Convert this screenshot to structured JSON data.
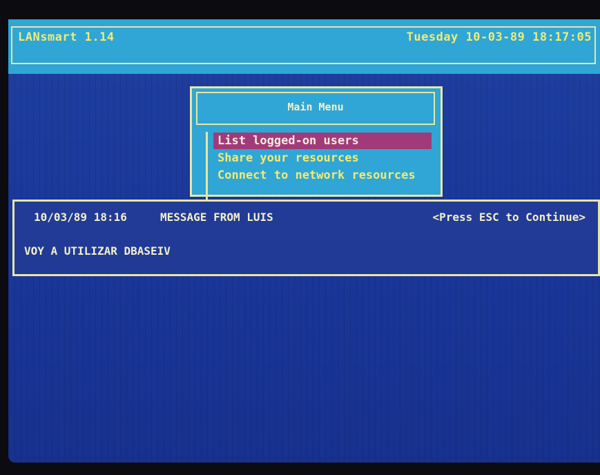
{
  "header": {
    "app_title": "LANsmart 1.14",
    "datetime": "Tuesday 10-03-89 18:17:05"
  },
  "menu": {
    "title": "Main Menu",
    "items": [
      {
        "label": "List logged-on users",
        "selected": true
      },
      {
        "label": "Share your resources",
        "selected": false
      },
      {
        "label": "Connect to network resources",
        "selected": false
      }
    ]
  },
  "message": {
    "date_time": "10/03/89 18:16",
    "from": "MESSAGE FROM LUIS",
    "hint": "<Press ESC to Continue>",
    "body": "VOY A UTILIZAR DBASEIV"
  },
  "colors": {
    "background": "#1f3fa0",
    "header": "#2fa6d6",
    "text_yellow": "#f2ea72",
    "selected": "#a13a78",
    "border": "#e8e6a4"
  }
}
